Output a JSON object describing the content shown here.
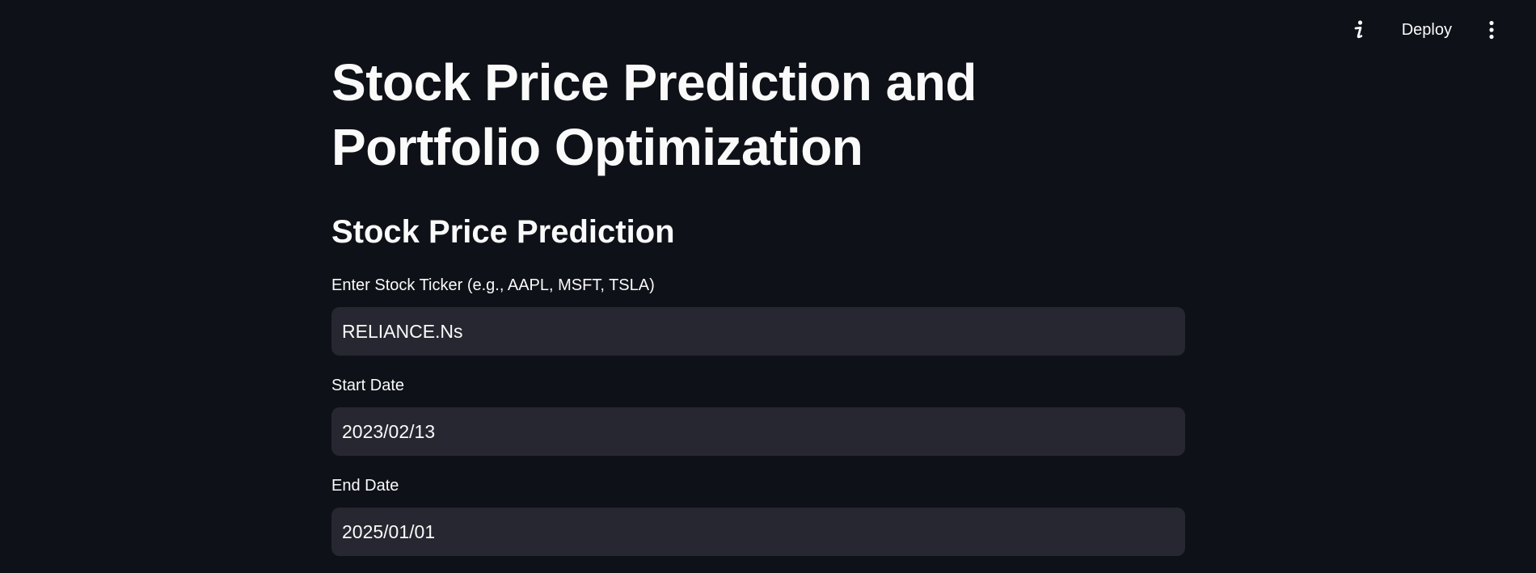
{
  "header": {
    "about_icon": "info-icon",
    "deploy_label": "Deploy",
    "menu_icon": "vertical-dots-icon"
  },
  "main": {
    "title": "Stock Price Prediction and Portfolio Optimization",
    "section_heading": "Stock Price Prediction",
    "fields": {
      "ticker": {
        "label": "Enter Stock Ticker (e.g., AAPL, MSFT, TSLA)",
        "value": "RELIANCE.Ns"
      },
      "start_date": {
        "label": "Start Date",
        "value": "2023/02/13"
      },
      "end_date": {
        "label": "End Date",
        "value": "2025/01/01"
      }
    }
  },
  "colors": {
    "background": "#0e1117",
    "input_background": "#262730",
    "text": "#fafafa"
  }
}
